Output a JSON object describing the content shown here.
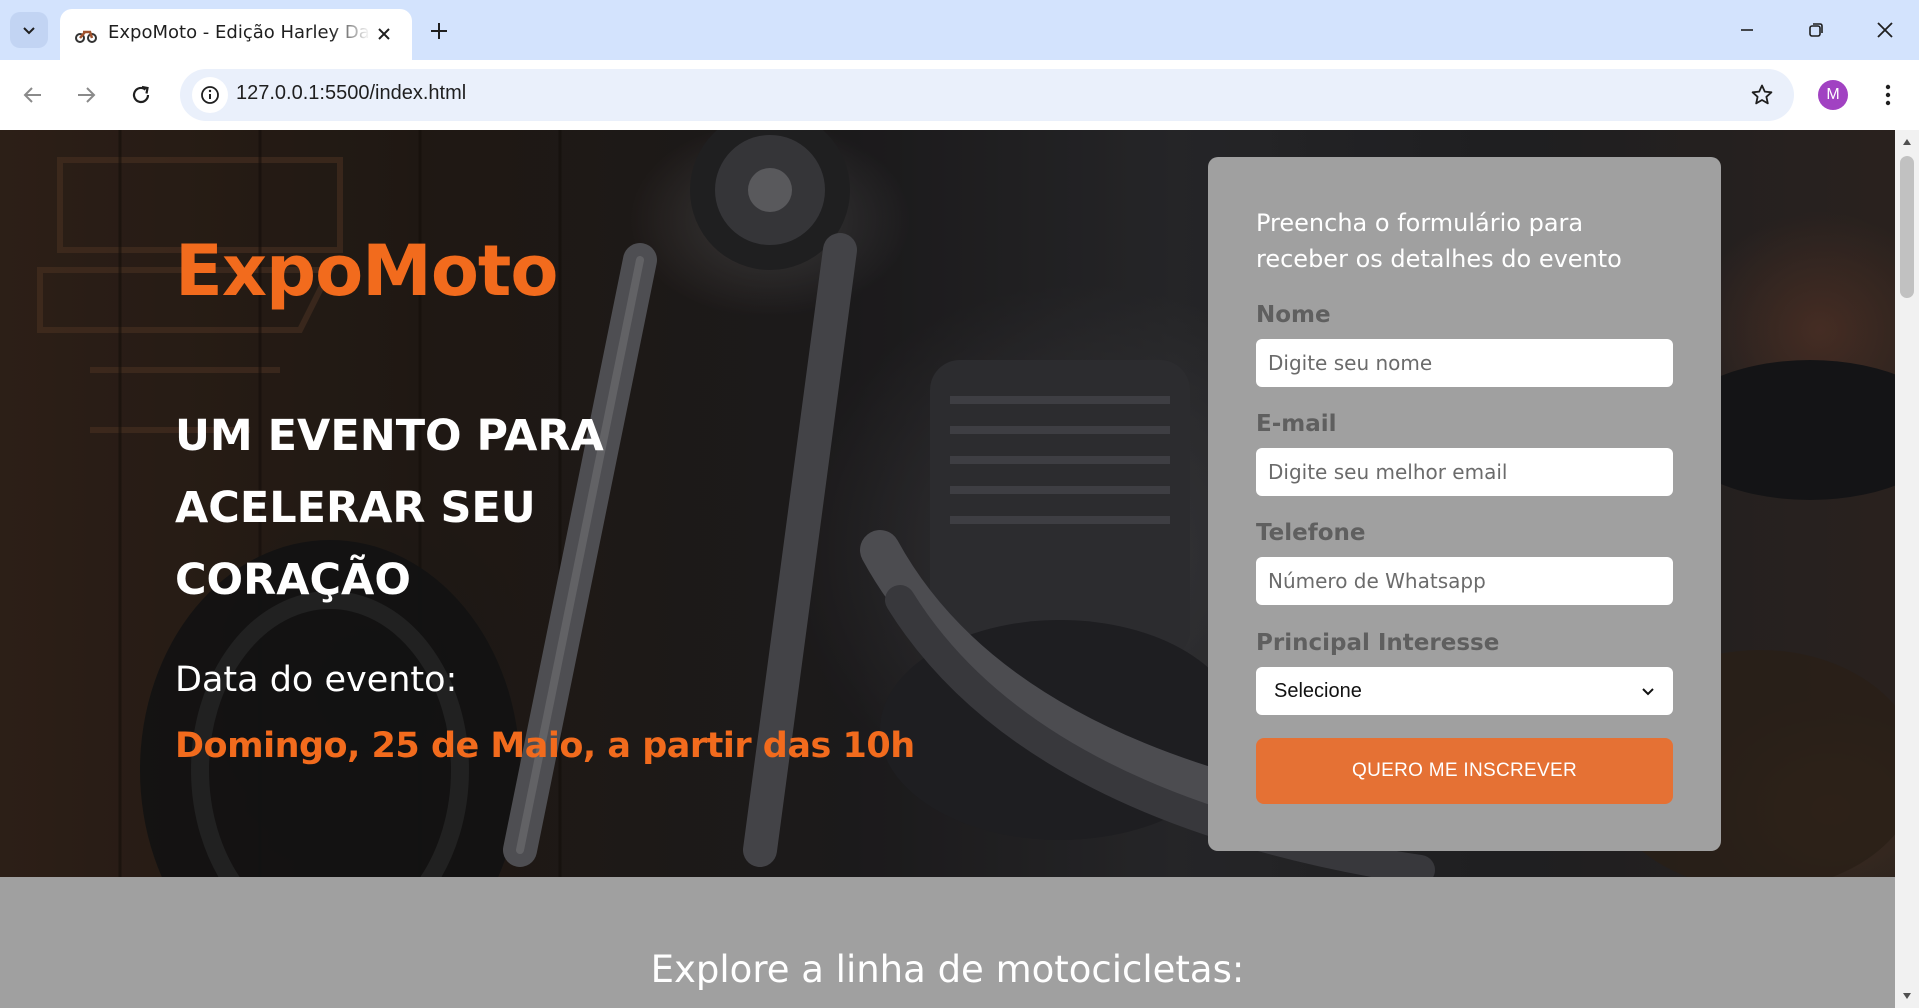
{
  "browser": {
    "tab_title": "ExpoMoto - Edição Harley Davidson",
    "url": "127.0.0.1:5500/index.html",
    "profile_initial": "M",
    "profile_color": "#a142c2"
  },
  "hero": {
    "brand": "ExpoMoto",
    "headline_lines": [
      "UM EVENTO PARA",
      "ACELERAR SEU",
      "CORAÇÃO"
    ],
    "date_label": "Data do evento:",
    "date_value": "Domingo, 25 de Maio, a partir das 10h",
    "accent_color": "#f26b1d"
  },
  "form": {
    "intro": "Preencha o formulário para receber os detalhes do evento",
    "name_label": "Nome",
    "name_placeholder": "Digite seu nome",
    "email_label": "E-mail",
    "email_placeholder": "Digite seu melhor email",
    "phone_label": "Telefone",
    "phone_placeholder": "Número de Whatsapp",
    "interest_label": "Principal Interesse",
    "interest_selected": "Selecione",
    "submit_label": "QUERO ME INSCREVER",
    "button_color": "#e57134"
  },
  "section": {
    "explore_title": "Explore a linha de motocicletas:"
  }
}
